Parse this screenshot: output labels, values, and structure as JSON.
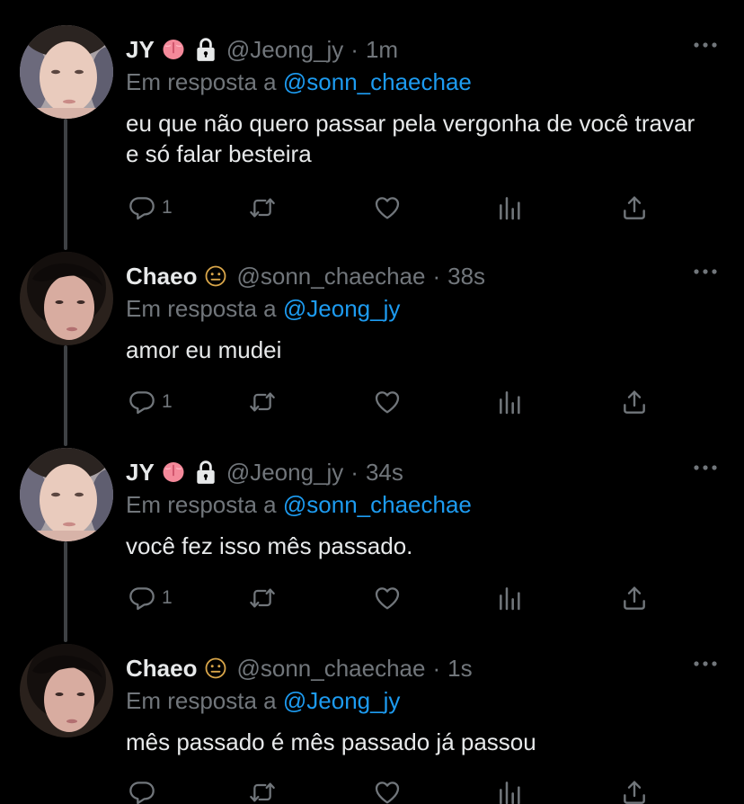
{
  "reply_prefix": "Em resposta a",
  "colors": {
    "background": "#000000",
    "text": "#e7e9ea",
    "muted": "#71767b",
    "link": "#1d9bf0",
    "thread_line": "#3e4144"
  },
  "tweets": [
    {
      "name": "JY",
      "handle": "@Jeong_jy",
      "sep": "·",
      "time": "1m",
      "badge_icons": [
        "tongue-emoji",
        "lock-icon"
      ],
      "reply_to": "@sonn_chaechae",
      "text": "eu que não quero passar pela vergonha de você travar e só falar besteira",
      "reply_count": "1"
    },
    {
      "name": "Chaeo",
      "handle": "@sonn_chaechae",
      "sep": "·",
      "time": "38s",
      "badge_icons": [
        "smiley-emoji"
      ],
      "reply_to": "@Jeong_jy",
      "text": "amor eu mudei",
      "reply_count": "1"
    },
    {
      "name": "JY",
      "handle": "@Jeong_jy",
      "sep": "·",
      "time": "34s",
      "badge_icons": [
        "tongue-emoji",
        "lock-icon"
      ],
      "reply_to": "@sonn_chaechae",
      "text": "você fez isso mês passado.",
      "reply_count": "1"
    },
    {
      "name": "Chaeo",
      "handle": "@sonn_chaechae",
      "sep": "·",
      "time": "1s",
      "badge_icons": [
        "smiley-emoji"
      ],
      "reply_to": "@Jeong_jy",
      "text": "mês passado é mês passado já passou",
      "reply_count": ""
    }
  ]
}
